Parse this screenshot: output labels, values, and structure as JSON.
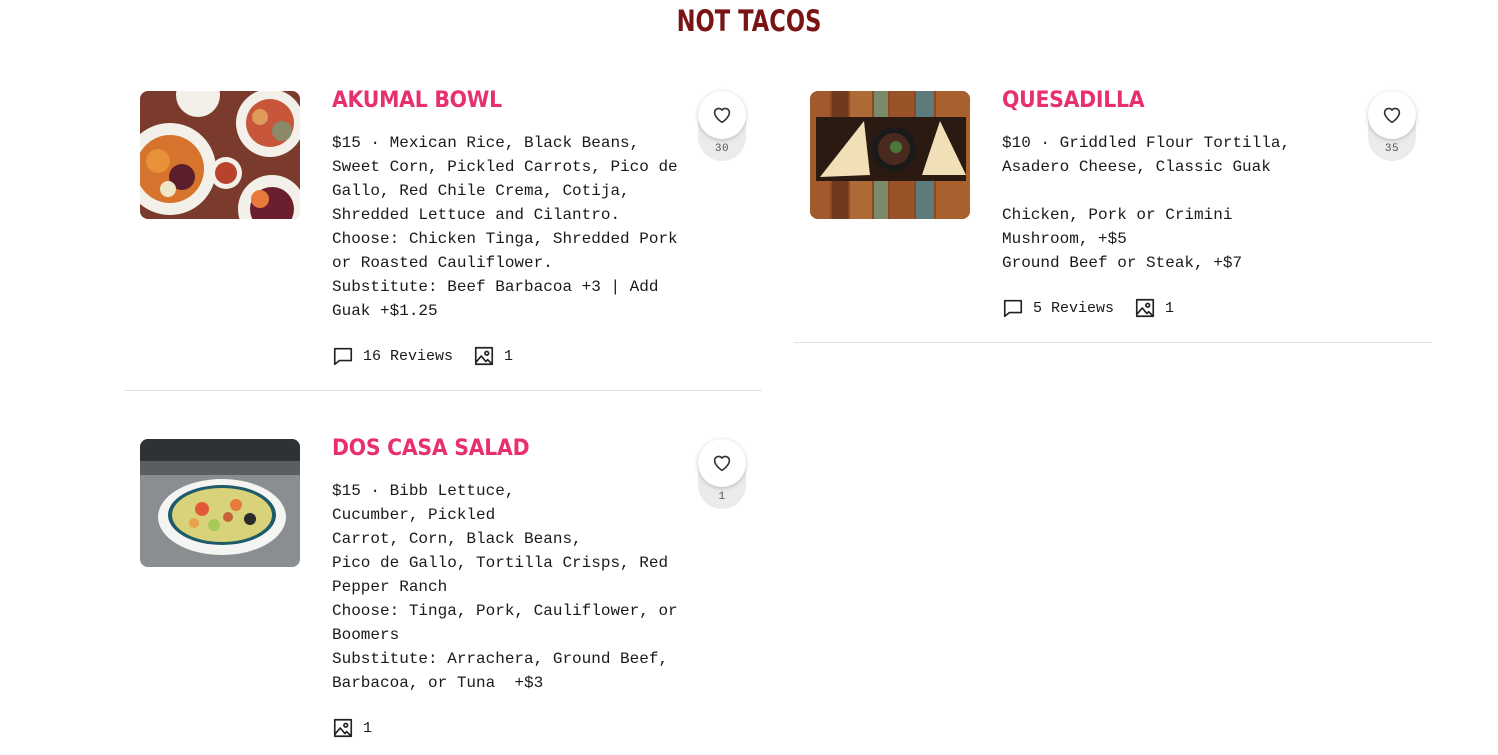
{
  "section": {
    "title": "NOT TACOS"
  },
  "items": [
    {
      "name": "AKUMAL BOWL",
      "description": "$15 · Mexican Rice, Black Beans,\nSweet Corn, Pickled Carrots, Pico de\nGallo, Red Chile Crema, Cotija,\nShredded Lettuce and Cilantro.\nChoose: Chicken Tinga, Shredded Pork\nor Roasted Cauliflower.\nSubstitute: Beef Barbacoa +3 | Add\nGuak +$1.25",
      "reviews": "16 Reviews",
      "photos": "1",
      "likes": "30"
    },
    {
      "name": "QUESADILLA",
      "description": "$10 · Griddled Flour Tortilla,\nAsadero Cheese, Classic Guak\n\nChicken, Pork or Crimini\nMushroom, +$5\nGround Beef or Steak, +$7",
      "reviews": "5 Reviews",
      "photos": "1",
      "likes": "35"
    },
    {
      "name": "DOS CASA SALAD",
      "description": "$15 · Bibb Lettuce,\nCucumber, Pickled\nCarrot, Corn, Black Beans,\nPico de Gallo, Tortilla Crisps, Red\nPepper Ranch\nChoose: Tinga, Pork, Cauliflower, or\nBoomers\nSubstitute: Arrachera, Ground Beef,\nBarbacoa, or Tuna  +$3",
      "photos": "1",
      "likes": "1"
    }
  ],
  "icons": {
    "heart": "heart-icon",
    "comment": "comment-icon",
    "image": "image-icon"
  },
  "colors": {
    "title": "#7a1414",
    "item_name": "#e8306e",
    "like_bg": "#ebebeb",
    "divider": "#e3e3e3"
  }
}
